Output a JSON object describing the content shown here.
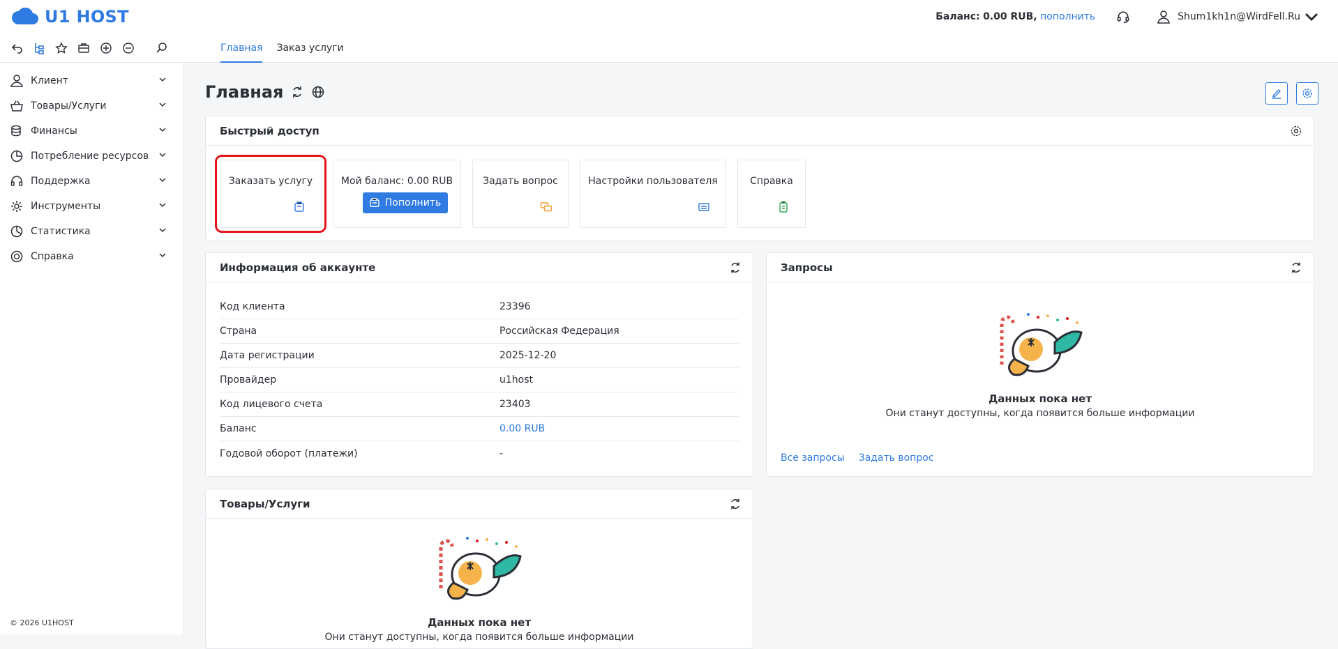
{
  "app": {
    "name": "U1 HOST"
  },
  "header": {
    "balance_label": "Баланс:",
    "balance_value": "0.00 RUB,",
    "topup_link": "пополнить",
    "user_email": "Shum1kh1n@WirdFell.Ru"
  },
  "tabs": [
    {
      "label": "Главная"
    },
    {
      "label": "Заказ услуги"
    }
  ],
  "sidebar": {
    "items": [
      {
        "label": "Клиент",
        "icon": "client-icon"
      },
      {
        "label": "Товары/Услуги",
        "icon": "basket-icon"
      },
      {
        "label": "Финансы",
        "icon": "coins-icon"
      },
      {
        "label": "Потребление ресурсов",
        "icon": "pie-icon"
      },
      {
        "label": "Поддержка",
        "icon": "headset-icon"
      },
      {
        "label": "Инструменты",
        "icon": "gear-icon"
      },
      {
        "label": "Статистика",
        "icon": "chart-icon"
      },
      {
        "label": "Справка",
        "icon": "lifebuoy-icon"
      }
    ],
    "copyright": "© 2026 U1HOST"
  },
  "page": {
    "title": "Главная"
  },
  "quick_access": {
    "title": "Быстрый доступ",
    "cards": [
      {
        "label": "Заказать услугу",
        "icon": "order-icon",
        "color": "#2f7be1"
      },
      {
        "label": "Мой баланс: 0.00 RUB",
        "button": "Пополнить"
      },
      {
        "label": "Задать вопрос",
        "icon": "chat-icon",
        "color": "#f39c34"
      },
      {
        "label": "Настройки пользователя",
        "icon": "settings-card-icon",
        "color": "#2f7be1"
      },
      {
        "label": "Справка",
        "icon": "help-doc-icon",
        "color": "#2fa84f"
      }
    ]
  },
  "account": {
    "title": "Информация об аккаунте",
    "rows": [
      {
        "key": "Код клиента",
        "value": "23396"
      },
      {
        "key": "Страна",
        "value": "Российская Федерация"
      },
      {
        "key": "Дата регистрации",
        "value": "2025-12-20"
      },
      {
        "key": "Провайдер",
        "value": "u1host"
      },
      {
        "key": "Код лицевого счета",
        "value": "23403"
      },
      {
        "key": "Баланс",
        "value": "0.00 RUB"
      },
      {
        "key": "Годовой оборот (платежи)",
        "value": "-"
      }
    ]
  },
  "requests": {
    "title": "Запросы",
    "empty_title": "Данных пока нет",
    "empty_sub": "Они станут доступны, когда появится больше информации",
    "links": [
      "Все запросы",
      "Задать вопрос"
    ]
  },
  "goods": {
    "title": "Товары/Услуги",
    "empty_title": "Данных пока нет",
    "empty_sub": "Они станут доступны, когда появится больше информации"
  },
  "colors": {
    "accent": "#2f7be1",
    "highlight": "#e3161b"
  }
}
